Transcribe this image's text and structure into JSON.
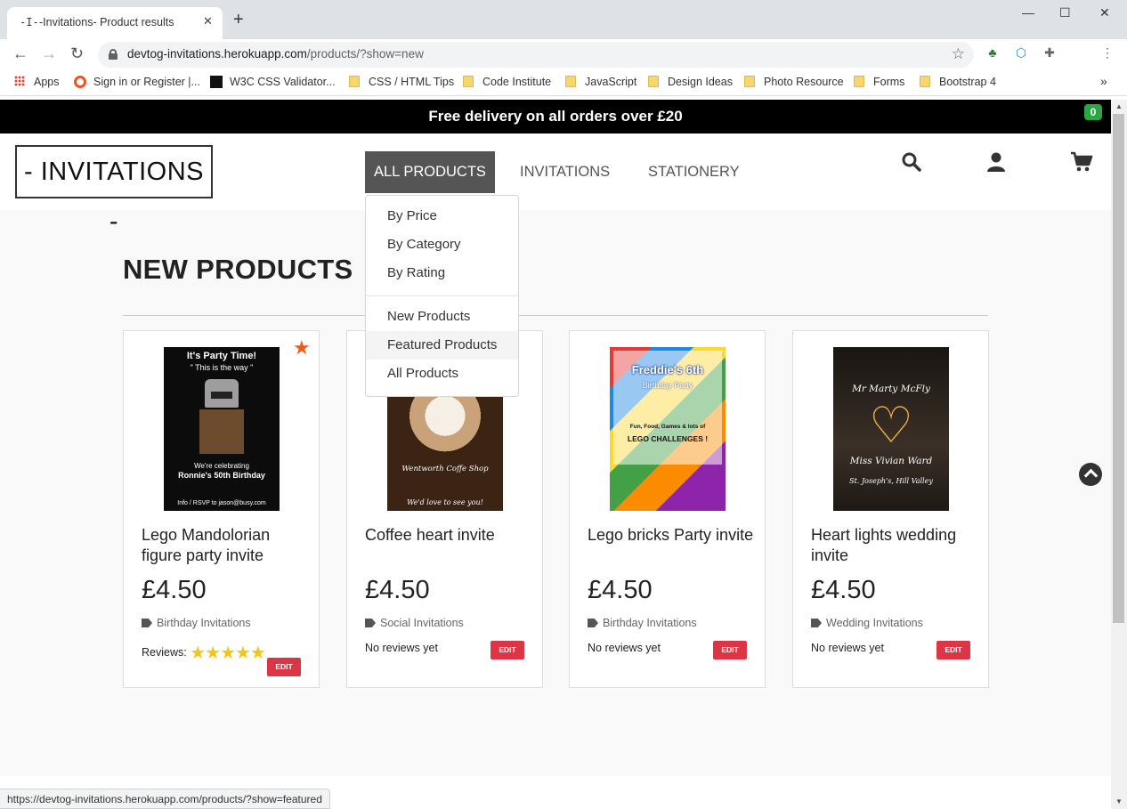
{
  "browser": {
    "tab_title": "-Invitations- Product results",
    "tab_favicon": "-I-",
    "url_host": "devtog-invitations.herokuapp.com",
    "url_path": "/products/?show=new",
    "bookmarks": [
      "Apps",
      "Sign in or Register |...",
      "W3C CSS Validator...",
      "CSS / HTML Tips",
      "Code Institute",
      "JavaScript",
      "Design Ideas",
      "Photo Resource",
      "Forms",
      "Bootstrap 4"
    ],
    "status_url": "https://devtog-invitations.herokuapp.com/products/?show=featured"
  },
  "banner": "Free delivery on all orders over £20",
  "logo": "- INVITATIONS -",
  "nav": [
    "All Products",
    "Invitations",
    "Stationery"
  ],
  "cart_count": "0",
  "dropdown": [
    "By Price",
    "By Category",
    "By Rating",
    "New Products",
    "Featured Products",
    "All Products"
  ],
  "section_title": "NEW PRODUCTS",
  "products": [
    {
      "name": "Lego Mandolorian figure party invite",
      "price": "£4.50",
      "category": "Birthday Invitations",
      "reviews": "Reviews:",
      "rating": 5,
      "edit": "EDIT",
      "image_text": [
        "It's Party Time!",
        "\" This is the way \"",
        "We're celebrating",
        "Ronnie's 50th Birthday",
        "Info / RSVP to jason@busy.com"
      ]
    },
    {
      "name": "Coffee heart invite",
      "price": "£4.50",
      "category": "Social Invitations",
      "reviews": "No reviews yet",
      "edit": "EDIT",
      "image_text": [
        "Wentworth Coffe Shop",
        "We'd love to see you!"
      ]
    },
    {
      "name": "Lego bricks Party invite",
      "price": "£4.50",
      "category": "Birthday Invitations",
      "reviews": "No reviews yet",
      "edit": "EDIT",
      "image_text": [
        "Freddie's 6th",
        "Birthday Party",
        "Fun, Food, Games & lots of",
        "LEGO CHALLENGES !"
      ]
    },
    {
      "name": "Heart lights wedding invite",
      "price": "£4.50",
      "category": "Wedding Invitations",
      "reviews": "No reviews yet",
      "edit": "EDIT",
      "image_text": [
        "Mr Marty McFly",
        "Miss Vivian Ward",
        "St. Joseph's, Hill Valley"
      ]
    }
  ]
}
